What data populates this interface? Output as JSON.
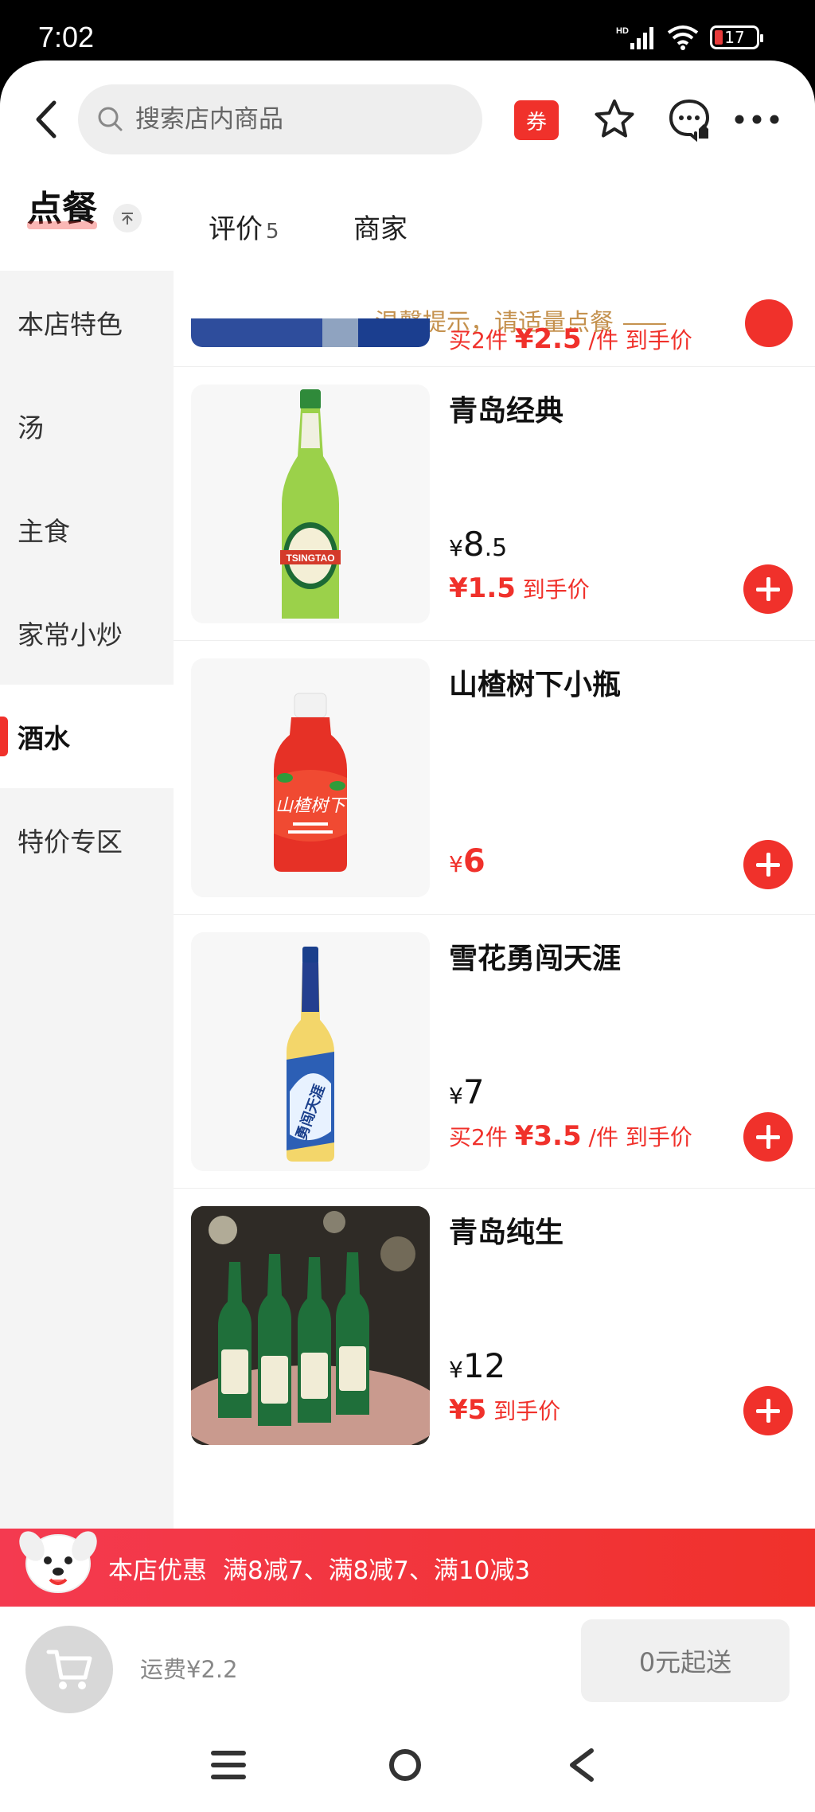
{
  "status_bar": {
    "time": "7:02",
    "network": "HD",
    "battery": "17"
  },
  "header": {
    "search_placeholder": "搜索店内商品",
    "coupon_label": "券",
    "icons": [
      "back-icon",
      "search-icon",
      "coupon-icon",
      "star-icon",
      "chat-icon",
      "more-icon"
    ]
  },
  "tabs": {
    "order": "点餐",
    "reviews": "评价",
    "reviews_count": "5",
    "merchant": "商家"
  },
  "sidebar": {
    "items": [
      {
        "label": "本店特色"
      },
      {
        "label": "汤"
      },
      {
        "label": "主食"
      },
      {
        "label": "家常小炒"
      },
      {
        "label": "酒水"
      },
      {
        "label": "特价专区"
      }
    ],
    "active_index": 4
  },
  "content": {
    "tip": "温馨提示，请适量点餐",
    "partial_item": {
      "promo_prefix": "买2件",
      "promo_price": "¥2.5",
      "promo_suffix": "/件 到手价"
    },
    "products": [
      {
        "name": "青岛经典",
        "price_symbol": "¥",
        "price_int": "8",
        "price_dec": ".5",
        "promo_prefix": "",
        "promo_price": "¥1.5",
        "promo_suffix": "到手价"
      },
      {
        "name": "山楂树下小瓶",
        "price_symbol": "¥",
        "price_int": "6"
      },
      {
        "name": "雪花勇闯天涯",
        "price_symbol": "¥",
        "price_int": "7",
        "promo_prefix": "买2件",
        "promo_price": "¥3.5",
        "promo_suffix": "/件 到手价"
      },
      {
        "name": "青岛纯生",
        "price_symbol": "¥",
        "price_int": "12",
        "promo_prefix": "",
        "promo_price": "¥5",
        "promo_suffix": "到手价"
      }
    ]
  },
  "promo_bar": {
    "title": "本店优惠",
    "details": "满8减7、满8减7、满10减3"
  },
  "cart": {
    "delivery_fee": "运费¥2.2",
    "min_order": "0元起送"
  },
  "colors": {
    "accent": "#f0312b",
    "tip": "#c4914e",
    "sidebar_bg": "#f4f4f4"
  }
}
